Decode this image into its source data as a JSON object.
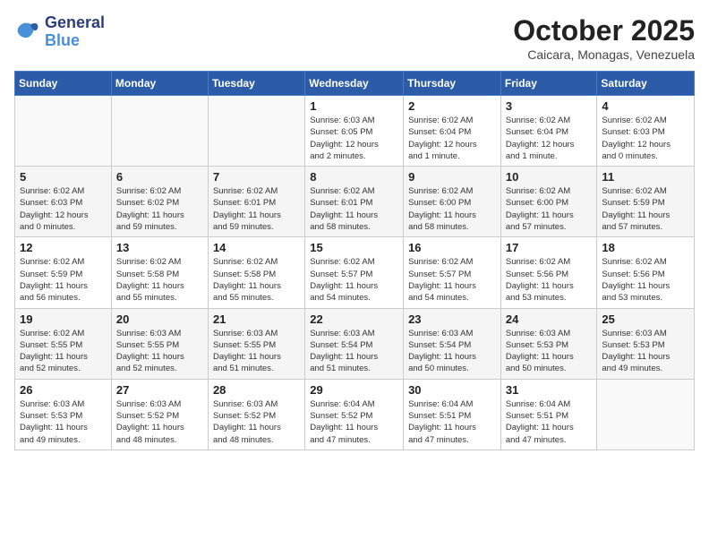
{
  "header": {
    "logo_line1": "General",
    "logo_line2": "Blue",
    "month": "October 2025",
    "location": "Caicara, Monagas, Venezuela"
  },
  "weekdays": [
    "Sunday",
    "Monday",
    "Tuesday",
    "Wednesday",
    "Thursday",
    "Friday",
    "Saturday"
  ],
  "weeks": [
    [
      {
        "day": "",
        "info": ""
      },
      {
        "day": "",
        "info": ""
      },
      {
        "day": "",
        "info": ""
      },
      {
        "day": "1",
        "info": "Sunrise: 6:03 AM\nSunset: 6:05 PM\nDaylight: 12 hours\nand 2 minutes."
      },
      {
        "day": "2",
        "info": "Sunrise: 6:02 AM\nSunset: 6:04 PM\nDaylight: 12 hours\nand 1 minute."
      },
      {
        "day": "3",
        "info": "Sunrise: 6:02 AM\nSunset: 6:04 PM\nDaylight: 12 hours\nand 1 minute."
      },
      {
        "day": "4",
        "info": "Sunrise: 6:02 AM\nSunset: 6:03 PM\nDaylight: 12 hours\nand 0 minutes."
      }
    ],
    [
      {
        "day": "5",
        "info": "Sunrise: 6:02 AM\nSunset: 6:03 PM\nDaylight: 12 hours\nand 0 minutes."
      },
      {
        "day": "6",
        "info": "Sunrise: 6:02 AM\nSunset: 6:02 PM\nDaylight: 11 hours\nand 59 minutes."
      },
      {
        "day": "7",
        "info": "Sunrise: 6:02 AM\nSunset: 6:01 PM\nDaylight: 11 hours\nand 59 minutes."
      },
      {
        "day": "8",
        "info": "Sunrise: 6:02 AM\nSunset: 6:01 PM\nDaylight: 11 hours\nand 58 minutes."
      },
      {
        "day": "9",
        "info": "Sunrise: 6:02 AM\nSunset: 6:00 PM\nDaylight: 11 hours\nand 58 minutes."
      },
      {
        "day": "10",
        "info": "Sunrise: 6:02 AM\nSunset: 6:00 PM\nDaylight: 11 hours\nand 57 minutes."
      },
      {
        "day": "11",
        "info": "Sunrise: 6:02 AM\nSunset: 5:59 PM\nDaylight: 11 hours\nand 57 minutes."
      }
    ],
    [
      {
        "day": "12",
        "info": "Sunrise: 6:02 AM\nSunset: 5:59 PM\nDaylight: 11 hours\nand 56 minutes."
      },
      {
        "day": "13",
        "info": "Sunrise: 6:02 AM\nSunset: 5:58 PM\nDaylight: 11 hours\nand 55 minutes."
      },
      {
        "day": "14",
        "info": "Sunrise: 6:02 AM\nSunset: 5:58 PM\nDaylight: 11 hours\nand 55 minutes."
      },
      {
        "day": "15",
        "info": "Sunrise: 6:02 AM\nSunset: 5:57 PM\nDaylight: 11 hours\nand 54 minutes."
      },
      {
        "day": "16",
        "info": "Sunrise: 6:02 AM\nSunset: 5:57 PM\nDaylight: 11 hours\nand 54 minutes."
      },
      {
        "day": "17",
        "info": "Sunrise: 6:02 AM\nSunset: 5:56 PM\nDaylight: 11 hours\nand 53 minutes."
      },
      {
        "day": "18",
        "info": "Sunrise: 6:02 AM\nSunset: 5:56 PM\nDaylight: 11 hours\nand 53 minutes."
      }
    ],
    [
      {
        "day": "19",
        "info": "Sunrise: 6:02 AM\nSunset: 5:55 PM\nDaylight: 11 hours\nand 52 minutes."
      },
      {
        "day": "20",
        "info": "Sunrise: 6:03 AM\nSunset: 5:55 PM\nDaylight: 11 hours\nand 52 minutes."
      },
      {
        "day": "21",
        "info": "Sunrise: 6:03 AM\nSunset: 5:55 PM\nDaylight: 11 hours\nand 51 minutes."
      },
      {
        "day": "22",
        "info": "Sunrise: 6:03 AM\nSunset: 5:54 PM\nDaylight: 11 hours\nand 51 minutes."
      },
      {
        "day": "23",
        "info": "Sunrise: 6:03 AM\nSunset: 5:54 PM\nDaylight: 11 hours\nand 50 minutes."
      },
      {
        "day": "24",
        "info": "Sunrise: 6:03 AM\nSunset: 5:53 PM\nDaylight: 11 hours\nand 50 minutes."
      },
      {
        "day": "25",
        "info": "Sunrise: 6:03 AM\nSunset: 5:53 PM\nDaylight: 11 hours\nand 49 minutes."
      }
    ],
    [
      {
        "day": "26",
        "info": "Sunrise: 6:03 AM\nSunset: 5:53 PM\nDaylight: 11 hours\nand 49 minutes."
      },
      {
        "day": "27",
        "info": "Sunrise: 6:03 AM\nSunset: 5:52 PM\nDaylight: 11 hours\nand 48 minutes."
      },
      {
        "day": "28",
        "info": "Sunrise: 6:03 AM\nSunset: 5:52 PM\nDaylight: 11 hours\nand 48 minutes."
      },
      {
        "day": "29",
        "info": "Sunrise: 6:04 AM\nSunset: 5:52 PM\nDaylight: 11 hours\nand 47 minutes."
      },
      {
        "day": "30",
        "info": "Sunrise: 6:04 AM\nSunset: 5:51 PM\nDaylight: 11 hours\nand 47 minutes."
      },
      {
        "day": "31",
        "info": "Sunrise: 6:04 AM\nSunset: 5:51 PM\nDaylight: 11 hours\nand 47 minutes."
      },
      {
        "day": "",
        "info": ""
      }
    ]
  ]
}
